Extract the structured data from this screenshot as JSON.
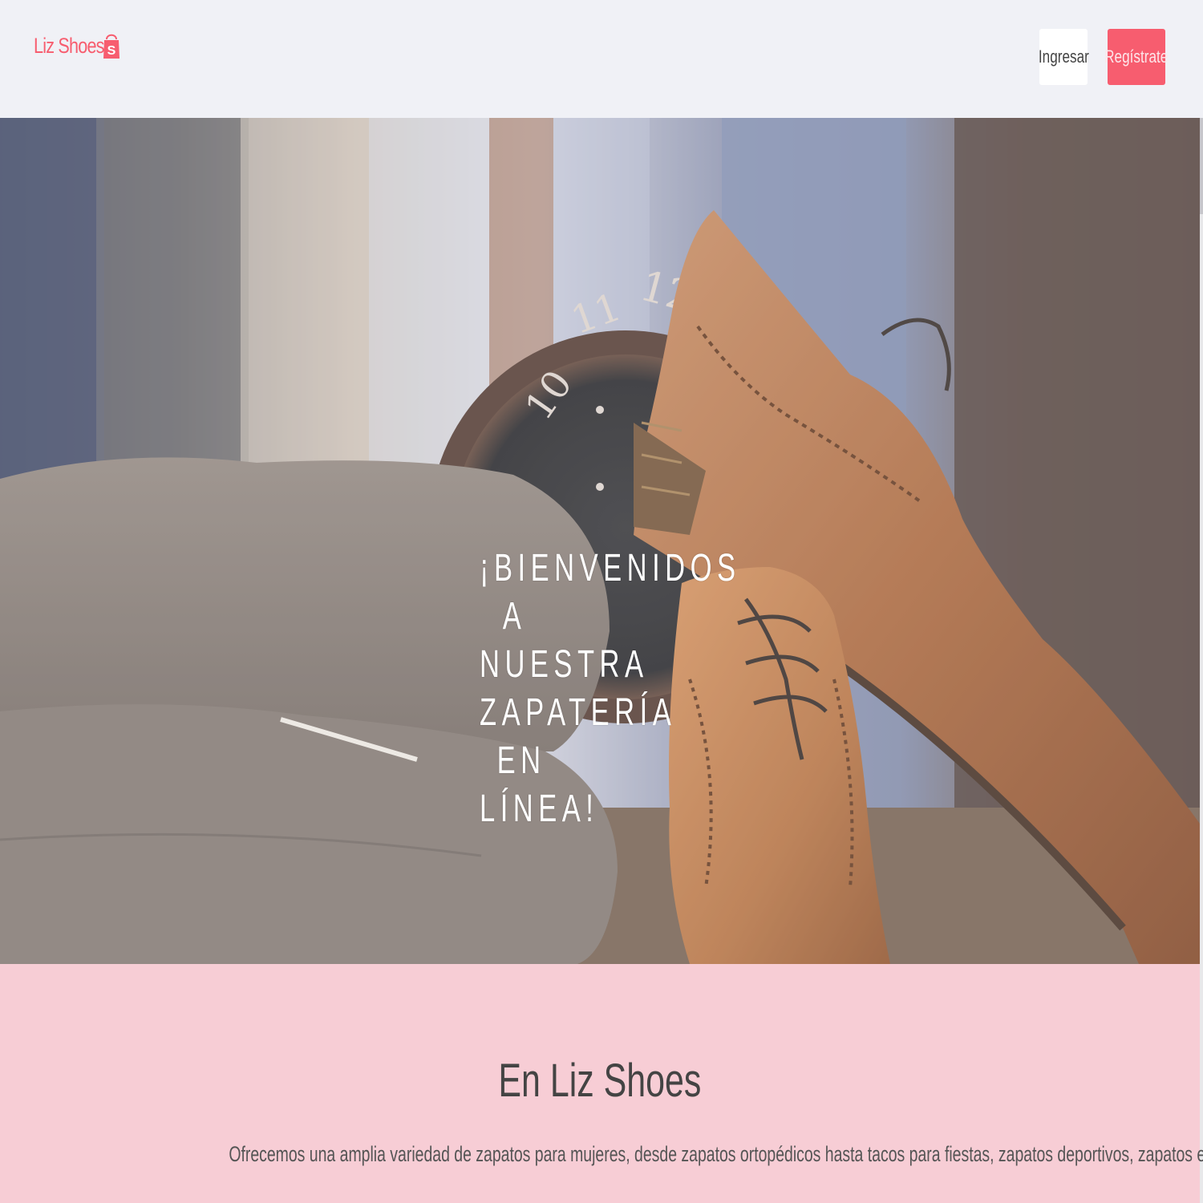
{
  "navbar": {
    "brand": "Liz Shoes",
    "brand_icon": "shopping-bag-icon",
    "login_label": "Ingresar",
    "register_label": "Regístrate",
    "colors": {
      "accent": "#f75d6f",
      "background": "#f0f1f6"
    }
  },
  "hero": {
    "title_lines": [
      "¡BIENVENIDOS",
      "A",
      "NUESTRA",
      "ZAPATERÍA",
      "EN",
      "LÍNEA!"
    ],
    "image": "brown-leather-shoes-sweaters-clock"
  },
  "info": {
    "title": "En Liz Shoes",
    "text": "Ofrecemos una amplia variedad de zapatos para mujeres, desde zapatos ortopédicos hasta tacos para fiestas, zapatos deportivos, zapatos escolares y botas industriales.",
    "background": "#f7cdd5"
  }
}
